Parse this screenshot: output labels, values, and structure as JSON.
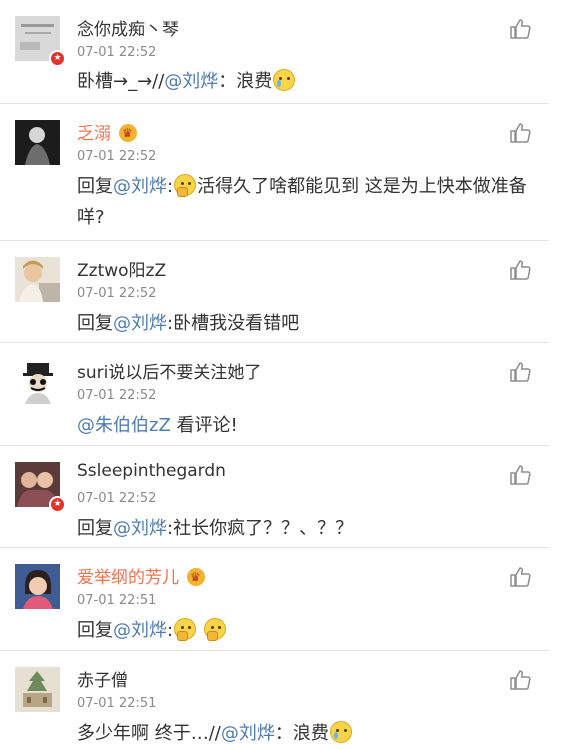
{
  "colors": {
    "mention": "#507daf",
    "vip_name": "#eb7350",
    "time": "#8a8a8a",
    "badge": "#e2332b"
  },
  "comments": [
    {
      "name": "念你成痴丶琴",
      "time": "07-01 22:52",
      "t1": "卧槽→_→//",
      "mention": "@刘烨",
      "t2": "：浪费"
    },
    {
      "name": "乏溺",
      "time": "07-01 22:52",
      "t1": "回复",
      "mention": "@刘烨",
      "t2": ":",
      "t3": "活得久了啥都能见到 这是为上快本做准备咩?"
    },
    {
      "name": "Zztwo阳zZ",
      "time": "07-01 22:52",
      "t1": "回复",
      "mention": "@刘烨",
      "t2": ":卧槽我没看错吧"
    },
    {
      "name": "suri说以后不要关注她了",
      "time": "07-01 22:52",
      "mention": "@朱伯伯zZ",
      "t2": " 看评论!"
    },
    {
      "name": "Ssleepinthegardn",
      "time": "07-01 22:52",
      "t1": "回复",
      "mention": "@刘烨",
      "t2": ":社长你疯了？？、？？"
    },
    {
      "name": "爱举纲的芳儿",
      "time": "07-01 22:51",
      "t1": "回复",
      "mention": "@刘烨",
      "t2": ":"
    },
    {
      "name": "赤子僧",
      "time": "07-01 22:51",
      "t1": "多少年啊 终于…//",
      "mention": "@刘烨",
      "t2": "：浪费"
    }
  ]
}
